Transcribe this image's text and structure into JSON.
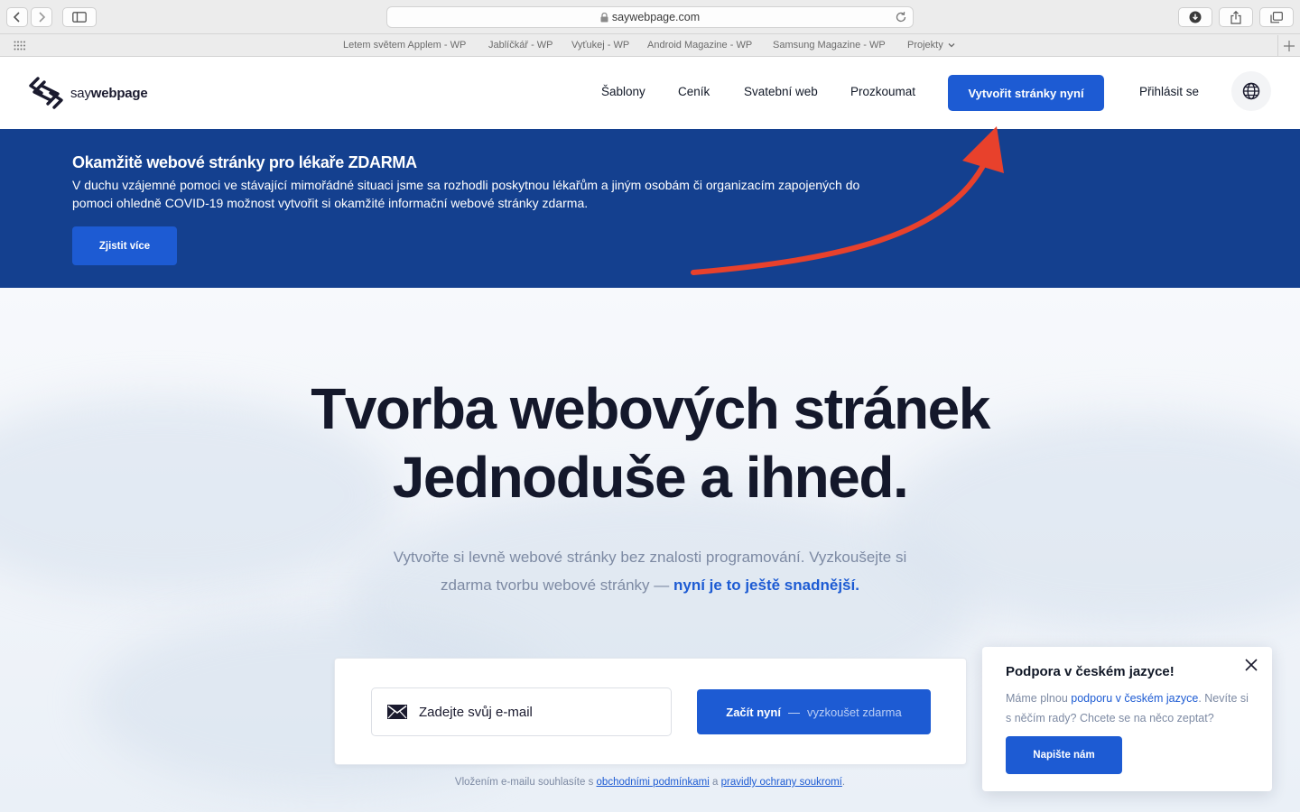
{
  "browser": {
    "url": "saywebpage.com",
    "favorites": [
      "Letem světem Applem - WP",
      "Jablíčkář - WP",
      "Vyťukej - WP",
      "Android Magazine - WP",
      "Samsung Magazine - WP",
      "Projekty"
    ]
  },
  "header": {
    "logo_prefix": "say",
    "logo_bold": "webpage",
    "nav": [
      "Šablony",
      "Ceník",
      "Svatební web",
      "Prozkoumat"
    ],
    "cta": "Vytvořit stránky nyní",
    "login": "Přihlásit se"
  },
  "banner": {
    "title": "Okamžitě webové stránky pro lékaře ZDARMA",
    "text": "V duchu vzájemné pomoci ve stávající mimořádné situaci jsme sa rozhodli poskytnou lékařům a jiným osobám či organizacím zapojených do pomoci ohledně COVID-19 možnost vytvořit si okamžité informační webové stránky zdarma.",
    "button": "Zjistit více",
    "annotation_color": "#e8412c"
  },
  "hero": {
    "title_line1": "Tvorba webových stránek",
    "title_line2": "Jednoduše a ihned.",
    "sub_line1": "Vytvořte si levně webové stránky bez znalosti programování. Vyzkoušejte si",
    "sub_line2_plain": "zdarma tvorbu webové stránky —",
    "sub_line2_highlight": "nyní je to ještě snadnější.",
    "email_placeholder": "Zadejte svůj e-mail",
    "start_bold": "Začít nyní",
    "start_dash": "—",
    "start_light": "vyzkoušet zdarma",
    "terms_prefix": "Vložením e-mailu souhlasíte s",
    "terms_link1": "obchodními podmínkami",
    "terms_mid": "a",
    "terms_link2": "pravidly ochrany soukromí",
    "terms_suffix": "."
  },
  "support": {
    "title": "Podpora v českém jazyce!",
    "text_before": "Máme plnou",
    "text_link": "podporu v českém jazyce",
    "text_after": ". Nevíte si s něčím rady? Chcete se na něco zeptat?",
    "button": "Napište nám"
  },
  "colors": {
    "primary": "#1d5bd3",
    "banner_bg": "#14408f",
    "heading": "#14182b",
    "muted": "#7d8aa3"
  }
}
